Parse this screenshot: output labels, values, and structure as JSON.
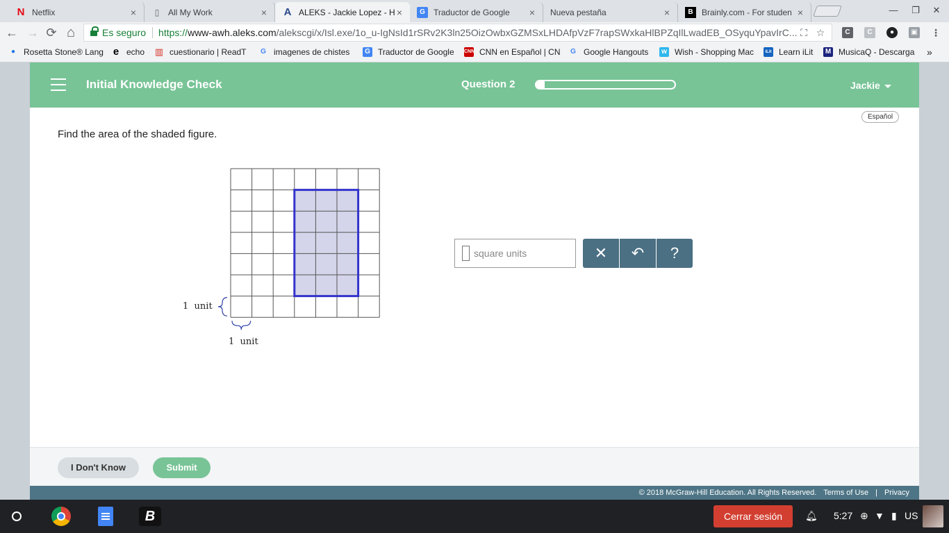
{
  "browser": {
    "tabs": [
      {
        "label": "Netflix",
        "icon": "netflix-icon",
        "glyph": "N",
        "color": "#e50914"
      },
      {
        "label": "All My Work",
        "icon": "document-icon",
        "glyph": "▯",
        "color": "#5f6368"
      },
      {
        "label": "ALEKS - Jackie Lopez - H",
        "icon": "aleks-icon",
        "glyph": "A",
        "color": "#2b4a8c"
      },
      {
        "label": "Traductor de Google",
        "icon": "google-translate-icon",
        "glyph": "G",
        "color": "#4285f4"
      },
      {
        "label": "Nueva pestaña",
        "icon": "",
        "glyph": "",
        "color": "#5f6368"
      },
      {
        "label": "Brainly.com - For studen",
        "icon": "brainly-icon",
        "glyph": "B",
        "color": "#000000"
      }
    ],
    "tab_close_glyph": "×",
    "nav": {
      "back": "←",
      "forward": "→",
      "reload": "⟳",
      "home": "⌂"
    },
    "secure_label": "Es seguro",
    "url_scheme": "https://",
    "url_host": "www-awh.aleks.com",
    "url_rest": "/alekscgi/x/Isl.exe/1o_u-IgNsId1rSRv2K3ln25OizOwbxGZMSxLHDAfpVzF7rapSWxkaHlBPZqIlLwadEB_OSyquYpavIrC...",
    "bookmarks": [
      {
        "label": "Rosetta Stone® Lang",
        "glyph": "●",
        "color": "#1a73e8"
      },
      {
        "label": "echo",
        "glyph": "e",
        "color": "#000000"
      },
      {
        "label": "cuestionario | ReadT",
        "glyph": "▥",
        "color": "#d93025"
      },
      {
        "label": "imagenes de chistes",
        "glyph": "G",
        "color": "#4285f4"
      },
      {
        "label": "Traductor de Google",
        "glyph": "G",
        "color": "#4285f4"
      },
      {
        "label": "CNN en Español | CN",
        "glyph": "CNN",
        "color": "#cc0000"
      },
      {
        "label": "Google Hangouts",
        "glyph": "G",
        "color": "#4285f4"
      },
      {
        "label": "Wish - Shopping Mac",
        "glyph": "w",
        "color": "#2fb7ec"
      },
      {
        "label": "Learn iLit",
        "glyph": "iLit",
        "color": "#1565c0"
      },
      {
        "label": "MusicaQ - Descarga",
        "glyph": "M",
        "color": "#1a237e"
      }
    ],
    "more_bookmarks": "»"
  },
  "aleks": {
    "title": "Initial Knowledge Check",
    "question_label": "Question 2",
    "progress_fraction": 0.06,
    "user": "Jackie",
    "language_button": "Español",
    "prompt": "Find the area of the shaded figure.",
    "figure": {
      "grid_cols": 7,
      "grid_rows": 7,
      "shaded_rect": {
        "col_start": 3,
        "row_start": 1,
        "cols": 3,
        "rows": 5
      },
      "unit_label_left": "1  unit",
      "unit_label_bottom": "1  unit",
      "shade_color": "#d4d4ea",
      "outline_color": "#3333cc"
    },
    "answer": {
      "value": "",
      "unit_placeholder": "square units"
    },
    "tools": {
      "clear": "✕",
      "undo": "↶",
      "help": "?"
    },
    "buttons": {
      "dont_know": "I Don't Know",
      "submit": "Submit"
    },
    "footer": {
      "copyright": "© 2018 McGraw-Hill Education. All Rights Reserved.",
      "terms": "Terms of Use",
      "separator": "|",
      "privacy": "Privacy"
    }
  },
  "shelf": {
    "logout": "Cerrar sesión",
    "time": "5:27",
    "locale": "US"
  },
  "colors": {
    "header_green": "#78c497",
    "tool_blue": "#4b6f83",
    "footer_bar": "#4e7586",
    "logout_red": "#d23f31"
  }
}
